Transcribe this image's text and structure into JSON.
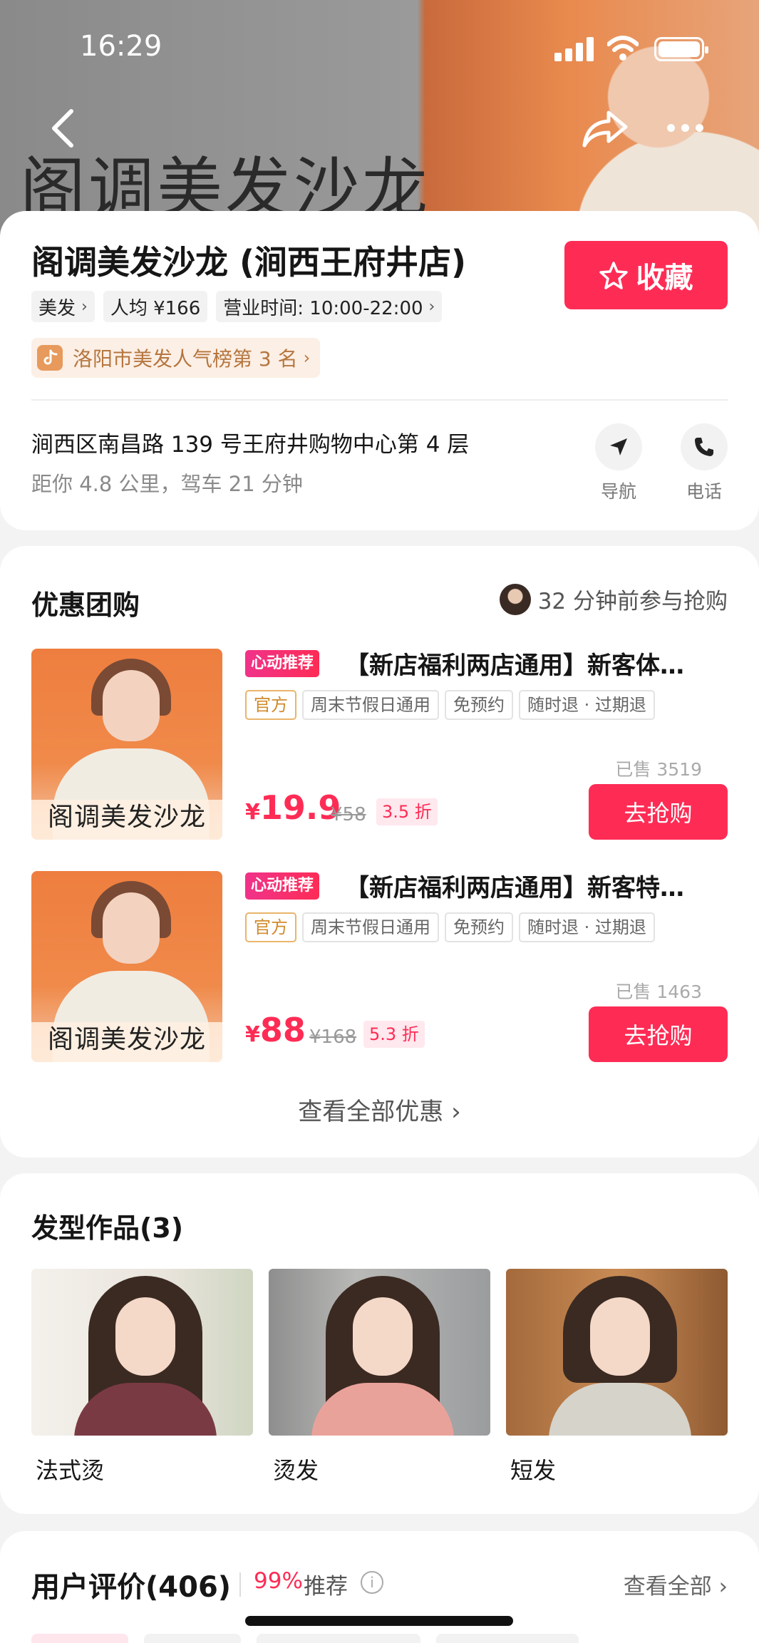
{
  "status_bar": {
    "time": "16:29"
  },
  "hero": {
    "sign_text": "阁调美发沙龙"
  },
  "shop": {
    "name": "阁调美发沙龙 (涧西王府井店)",
    "favorite_label": "收藏",
    "tags": [
      {
        "label": "美发"
      },
      {
        "label": "人均 ¥166"
      },
      {
        "label": "营业时间: 10:00-22:00"
      }
    ],
    "ranking": "洛阳市美发人气榜第 3 名",
    "address": "涧西区南昌路 139 号王府井购物中心第 4 层",
    "distance": "距你 4.8 公里，驾车 21 分钟",
    "actions": {
      "navigate": "导航",
      "phone": "电话"
    }
  },
  "deals": {
    "title": "优惠团购",
    "join_info": "32 分钟前参与抢购",
    "items": [
      {
        "badge": "心动推荐",
        "title": "【新店福利两店通用】新客体…",
        "thumb_caption": "阁调美发沙龙",
        "tags": [
          "官方",
          "周末节假日通用",
          "免预约",
          "随时退 · 过期退"
        ],
        "sold": "已售 3519",
        "currency": "¥",
        "price": "19.9",
        "original_price": "¥58",
        "discount": "3.5 折",
        "buy_label": "去抢购"
      },
      {
        "badge": "心动推荐",
        "title": "【新店福利两店通用】新客特…",
        "thumb_caption": "阁调美发沙龙",
        "tags": [
          "官方",
          "周末节假日通用",
          "免预约",
          "随时退 · 过期退"
        ],
        "sold": "已售 1463",
        "currency": "¥",
        "price": "88",
        "original_price": "¥168",
        "discount": "5.3 折",
        "buy_label": "去抢购"
      }
    ],
    "see_all": "查看全部优惠"
  },
  "works": {
    "title": "发型作品(3)",
    "items": [
      {
        "label": "法式烫"
      },
      {
        "label": "烫发"
      },
      {
        "label": "短发"
      }
    ]
  },
  "reviews": {
    "title": "用户评价(406)",
    "recommend_pct": "99%",
    "recommend_label": "推荐",
    "info_icon": "i",
    "see_all": "查看全部"
  },
  "colors": {
    "accent": "#fe2c55",
    "rank_text": "#b5763f",
    "official_tag": "#d08b2c"
  }
}
